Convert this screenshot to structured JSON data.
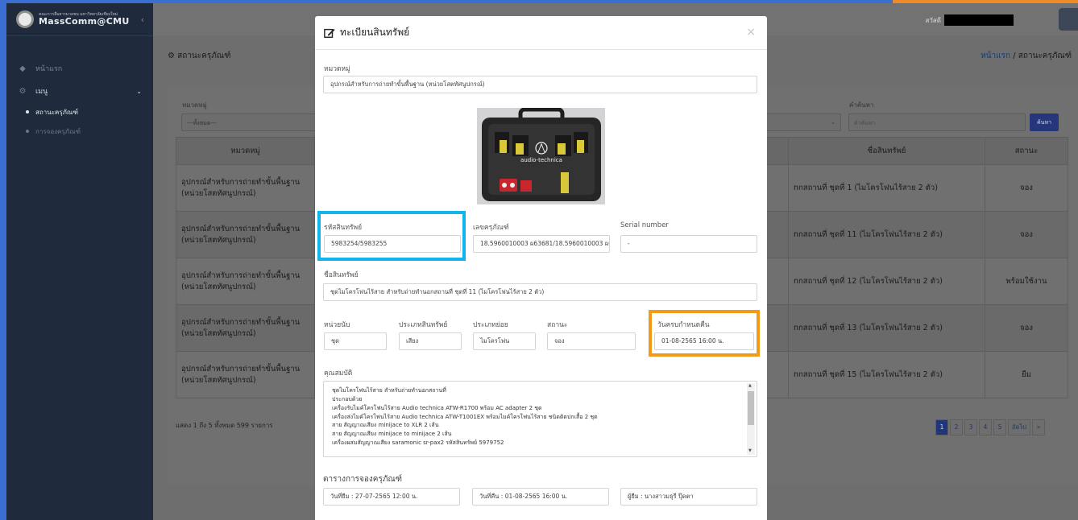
{
  "sidebar": {
    "brand_sub": "คณะการสื่อสารมวลชน มหาวิทยาลัยเชียงใหม่",
    "brand_name": "MassComm@CMU",
    "home": "หน้าแรก",
    "menu": "เมนู",
    "items": [
      {
        "label": "สถานะครุภัณฑ์",
        "active": true
      },
      {
        "label": "การจองครุภัณฑ์",
        "active": false
      }
    ]
  },
  "topbar": {
    "greeting": "สวัสดี"
  },
  "page": {
    "title": "สถานะครุภัณฑ์",
    "breadcrumb_home": "หน้าแรก",
    "breadcrumb_sep": "/",
    "breadcrumb_current": "สถานะครุภัณฑ์"
  },
  "filters": {
    "category_label": "หมวดหมู่",
    "category_value": "---ทั้งหมด---",
    "keyword_label": "คำค้นหา",
    "keyword_placeholder": "คำค้นหา",
    "search_button": "ค้นหา"
  },
  "table": {
    "headers": [
      "หมวดหมู่",
      "ชื่อสินทรัพย์",
      "สถานะ"
    ],
    "rows": [
      {
        "category": "อุปกรณ์สำหรับการถ่ายทำขั้นพื้นฐาน (หน่วยโสตทัศนูปกรณ์)",
        "name": "nกสถานที่ ชุดที่ 1 (ไมโครโฟนไร้สาย 2 ตัว)",
        "status": "จอง"
      },
      {
        "category": "อุปกรณ์สำหรับการถ่ายทำขั้นพื้นฐาน (หน่วยโสตทัศนูปกรณ์)",
        "name": "nกสถานที่ ชุดที่ 11 (ไมโครโฟนไร้สาย 2 ตัว)",
        "status": "จอง"
      },
      {
        "category": "อุปกรณ์สำหรับการถ่ายทำขั้นพื้นฐาน (หน่วยโสตทัศนูปกรณ์)",
        "name": "nกสถานที่ ชุดที่ 12 (ไมโครโฟนไร้สาย 2 ตัว)",
        "status": "พร้อมใช้งาน"
      },
      {
        "category": "อุปกรณ์สำหรับการถ่ายทำขั้นพื้นฐาน (หน่วยโสตทัศนูปกรณ์)",
        "name": "nกสถานที่ ชุดที่ 13 (ไมโครโฟนไร้สาย 2 ตัว)",
        "status": "จอง"
      },
      {
        "category": "อุปกรณ์สำหรับการถ่ายทำขั้นพื้นฐาน (หน่วยโสตทัศนูปกรณ์)",
        "name": "nกสถานที่ ชุดที่ 15 (ไมโครโฟนไร้สาย 2 ตัว)",
        "status": "ยืม"
      }
    ],
    "count_text": "แสดง 1 ถึง 5 ทั้งหมด 599 รายการ"
  },
  "pagination": {
    "pages": [
      "1",
      "2",
      "3",
      "4",
      "5",
      "ถัดไป",
      "»"
    ],
    "current": "1"
  },
  "modal": {
    "title": "ทะเบียนสินทรัพย์",
    "close": "×",
    "category_label": "หมวดหมู่",
    "category_value": "อุปกรณ์สำหรับการถ่ายทำขั้นพื้นฐาน (หน่วยโสตทัศนูปกรณ์)",
    "photo_brand": "audio-technica",
    "asset_code_label": "รหัสสินทรัพย์",
    "asset_code_value": "5983254/5983255",
    "equipment_no_label": "เลขครุภัณฑ์",
    "equipment_no_value": "18.5960010003 ผ63681/18.5960010003 ผ6",
    "serial_label": "Serial number",
    "serial_value": "-",
    "asset_name_label": "ชื่อสินทรัพย์",
    "asset_name_value": "ชุดไมโครโฟนไร้สาย สำหรับถ่ายทำนอกสถานที่ ชุดที่ 11 (ไมโครโฟนไร้สาย 2 ตัว)",
    "unit_label": "หน่วยนับ",
    "unit_value": "ชุด",
    "asset_type_label": "ประเภทสินทรัพย์",
    "asset_type_value": "เสียง",
    "subtype_label": "ประเภทย่อย",
    "subtype_value": "ไมโครโฟน",
    "status_label": "สถานะ",
    "status_value": "จอง",
    "due_label": "วันครบกำหนดคืน",
    "due_value": "01-08-2565 16:00 น.",
    "specs_label": "คุณสมบัติ",
    "specs_lines": [
      "ชุดไมโครโฟนไร้สาย สำหรับถ่ายทำนอกสถานที่",
      "ประกอบด้วย",
      "เครื่องรับไมค์โครโฟนไร้สาย Audio technica ATW-R1700 พร้อม AC adapter 2 ชุด",
      "เครื่องส่งไมค์โครโฟนไร้สาย Audio technica ATW-T1001EX พร้อมไมค์โครโฟนไร้สาย ชนิดติดปกเสื้อ 2 ชุด",
      "สาย สัญญาณเสียง minijace to XLR 2 เส้น",
      "สาย สัญญาณเสียง minijace to minijace 2 เส้น",
      "เครื่องผสมสัญญาณเสียง saramonic sr-pax2 รหัสสินทรัพย์  5979752"
    ],
    "booking_title": "ตารางการจองครุภัณฑ์",
    "borrow_date": "วันที่ยืม : 27-07-2565 12:00 น.",
    "return_date": "วันที่คืน : 01-08-2565 16:00 น.",
    "borrower": "ผู้ยืม : นางสาวมธุรี ปุ๊ดตา"
  },
  "colors": {
    "highlight_blue": "#12b5e9",
    "highlight_orange": "#f29b16",
    "sidebar_bg": "#1f2a3d",
    "primary": "#223579"
  }
}
